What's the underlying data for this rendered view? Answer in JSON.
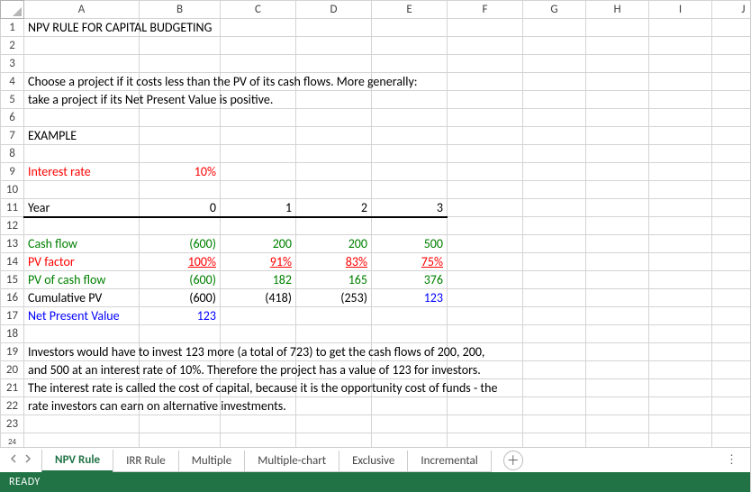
{
  "columns": [
    "A",
    "B",
    "C",
    "D",
    "E",
    "F",
    "G",
    "H",
    "I",
    "J"
  ],
  "rows": [
    "1",
    "2",
    "3",
    "4",
    "5",
    "6",
    "7",
    "8",
    "9",
    "10",
    "11",
    "12",
    "13",
    "14",
    "15",
    "16",
    "17",
    "18",
    "19",
    "20",
    "21",
    "22",
    "23",
    "24"
  ],
  "cells": {
    "r1A": "NPV RULE FOR CAPITAL BUDGETING",
    "r4A": "Choose a project if it costs less than the PV of its cash flows.  More generally:",
    "r5A": "take a project if its Net Present Value is positive.",
    "r7A": "EXAMPLE",
    "r9A": "Interest rate",
    "r9B": "10%",
    "r11A": "Year",
    "r11B": "0",
    "r11C": "1",
    "r11D": "2",
    "r11E": "3",
    "r13A": "Cash flow",
    "r13B": "(600)",
    "r13C": "200",
    "r13D": "200",
    "r13E": "500",
    "r14A": "PV factor",
    "r14B": "100%",
    "r14C": "91%",
    "r14D": "83%",
    "r14E": "75%",
    "r15A": "PV of cash flow",
    "r15B": "(600)",
    "r15C": "182",
    "r15D": "165",
    "r15E": "376",
    "r16A": "Cumulative PV",
    "r16B": "(600)",
    "r16C": "(418)",
    "r16D": "(253)",
    "r16E": "123",
    "r17A": "Net Present Value",
    "r17B": "123",
    "r19A": "Investors would have to invest 123 more (a total of 723) to get the cash flows of 200, 200,",
    "r20A": "and 500 at an interest rate of 10%.  Therefore the project has a value of 123 for investors.",
    "r21A": "The interest rate is called the cost of capital, because it is the opportunity cost of funds - the",
    "r22A": "rate investors can earn on alternative investments."
  },
  "tabs": [
    "NPV Rule",
    "IRR Rule",
    "Multiple",
    "Multiple-chart",
    "Exclusive",
    "Incremental"
  ],
  "activeTab": 0,
  "status": "READY",
  "icons": {
    "add": "＋",
    "more": "⋮"
  }
}
